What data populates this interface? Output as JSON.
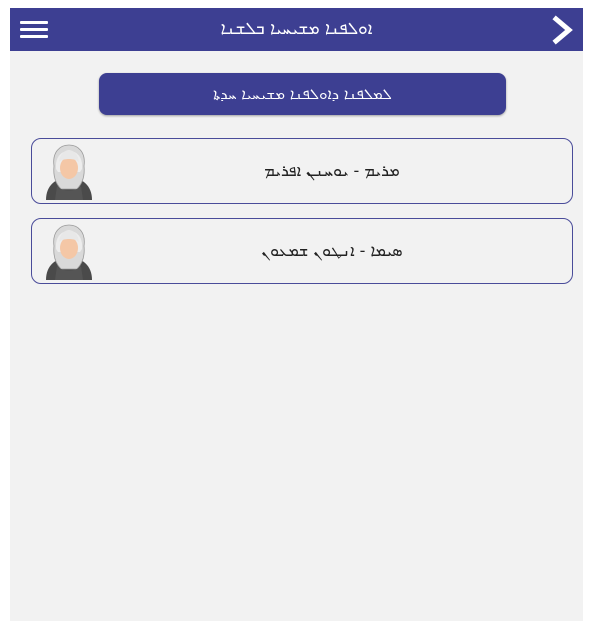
{
  "header": {
    "menu_icon": "hamburger-menu-icon",
    "title": "ܐܘܠܦܢܐ ܡܫܝܚܝܐ ܒܠܫܢܐ",
    "back_icon": "chevron-right-icon"
  },
  "action_button": {
    "label": "ܠܡܠܦܢܐ ܕܐܘܠܦܢܐ ܡܫܝܚܝܐ ܚܕܬܐ"
  },
  "teachers": [
    {
      "name": "ܡܪܝܡ - ܝܘܚܢܢ ܐܦܪܝܡ",
      "avatar_icon": "woman-avatar-icon"
    },
    {
      "name": "ܣܝܡܐ - ܐܢܛܘܢ ܫܡܥܘܢ",
      "avatar_icon": "woman-avatar-icon"
    }
  ],
  "colors": {
    "accent": "#3d3f92",
    "background": "#f2f2f2"
  }
}
